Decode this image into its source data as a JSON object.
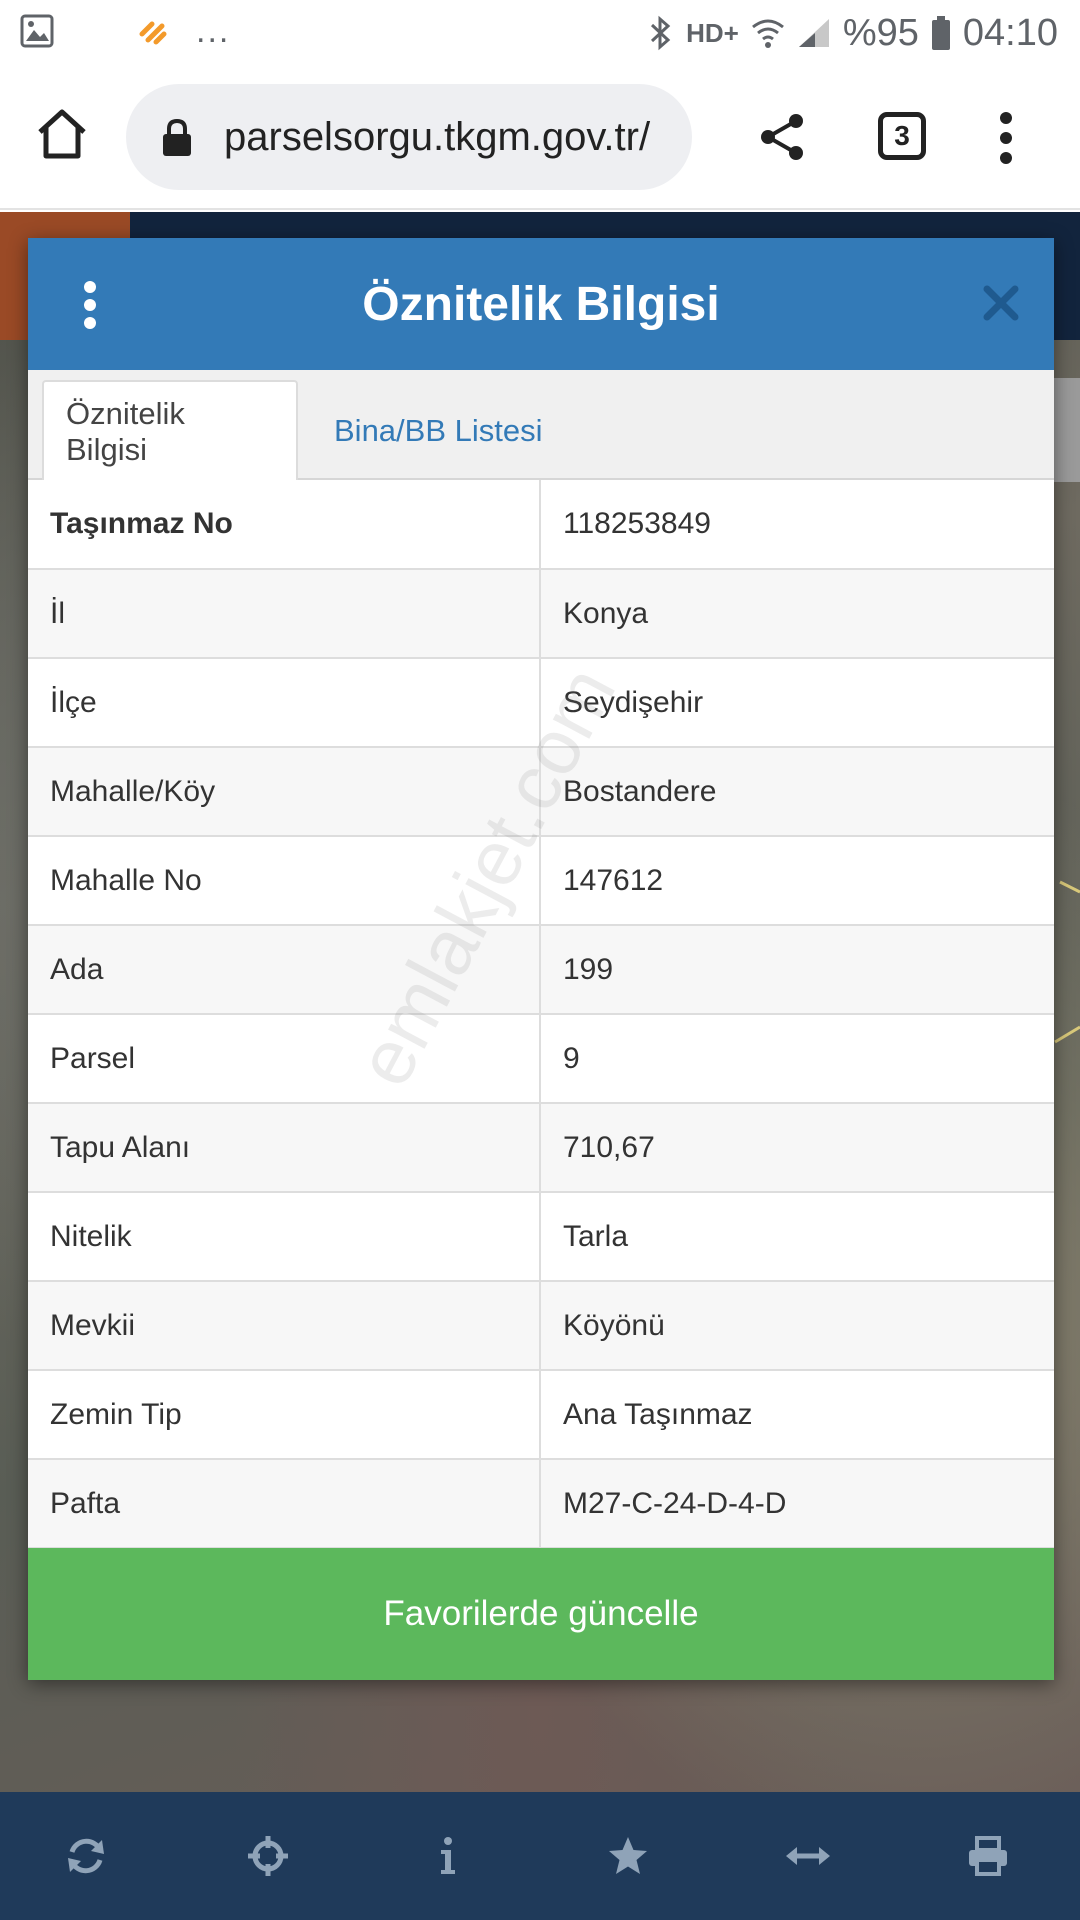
{
  "status_bar": {
    "left_dots": "...",
    "network_label": "HD+",
    "battery_text": "%95",
    "time": "04:10"
  },
  "browser": {
    "url": "parselsorgu.tkgm.gov.tr/",
    "tab_count": "3"
  },
  "modal": {
    "title": "Öznitelik Bilgisi",
    "tabs": [
      {
        "label": "Öznitelik Bilgisi",
        "active": true
      },
      {
        "label": "Bina/BB Listesi",
        "active": false
      }
    ],
    "rows": [
      {
        "key": "Taşınmaz No",
        "value": "118253849"
      },
      {
        "key": "İl",
        "value": "Konya"
      },
      {
        "key": "İlçe",
        "value": "Seydişehir"
      },
      {
        "key": "Mahalle/Köy",
        "value": "Bostandere"
      },
      {
        "key": "Mahalle No",
        "value": "147612"
      },
      {
        "key": "Ada",
        "value": "199"
      },
      {
        "key": "Parsel",
        "value": "9"
      },
      {
        "key": "Tapu Alanı",
        "value": "710,67"
      },
      {
        "key": "Nitelik",
        "value": "Tarla"
      },
      {
        "key": "Mevkii",
        "value": "Köyönü"
      },
      {
        "key": "Zemin Tip",
        "value": "Ana Taşınmaz"
      },
      {
        "key": "Pafta",
        "value": "M27-C-24-D-4-D"
      }
    ],
    "watermark": "emlakjet.com",
    "favorite_button_label": "Favorilerde güncelle"
  },
  "colors": {
    "header_blue": "#337ab7",
    "tab_link_blue": "#337ab7",
    "button_green": "#5cb85c",
    "bottom_bar": "#1f3a5a"
  },
  "icons": {
    "status_left": [
      "image-icon",
      "app-notification-icon"
    ],
    "status_right": [
      "bluetooth-icon",
      "wifi-icon",
      "signal-icon",
      "battery-icon"
    ],
    "toolbar": [
      "home-icon",
      "lock-icon",
      "share-icon",
      "tabs-icon",
      "more-vert-icon"
    ],
    "bottom": [
      "refresh-icon",
      "crosshair-icon",
      "info-icon",
      "star-icon",
      "measure-arrows-icon",
      "print-icon"
    ]
  }
}
